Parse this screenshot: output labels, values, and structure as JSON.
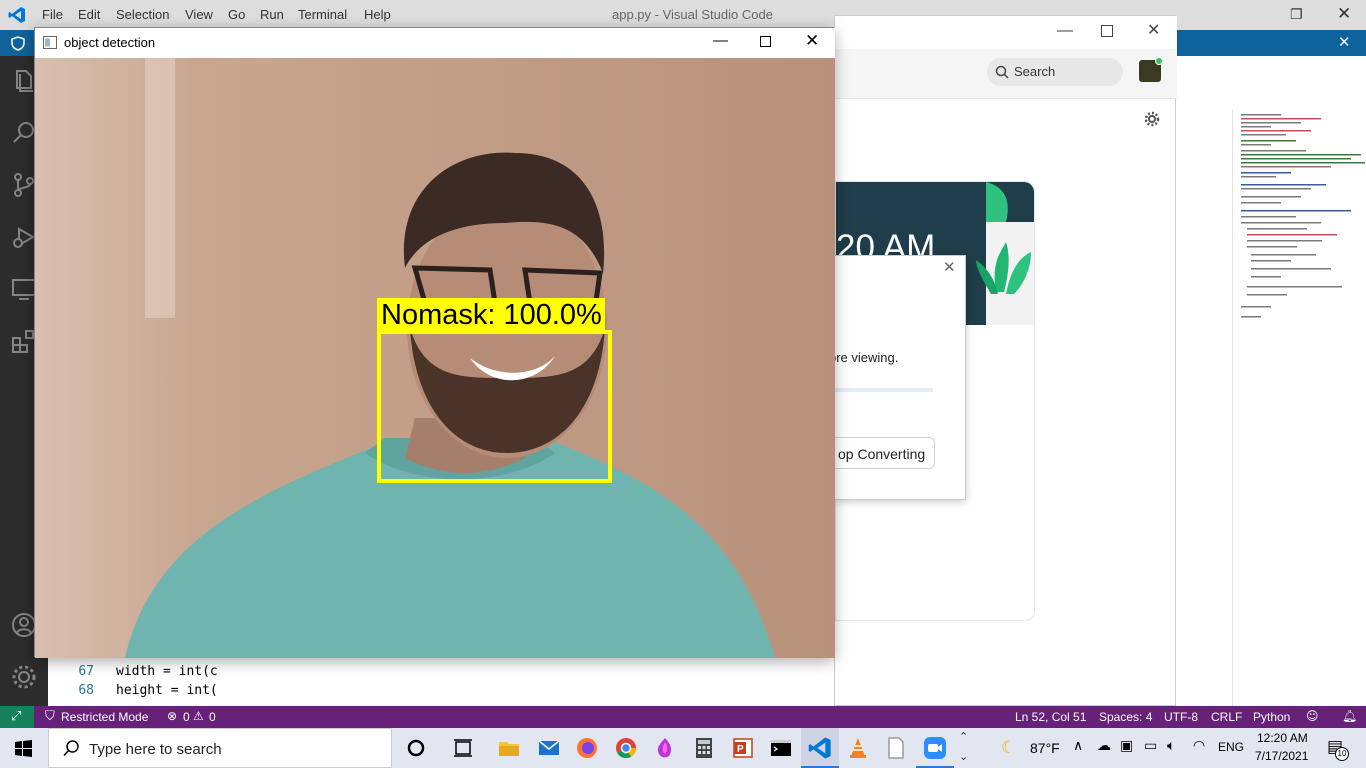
{
  "vscode": {
    "menu": [
      "File",
      "Edit",
      "Selection",
      "View",
      "Go",
      "Run",
      "Terminal",
      "Help"
    ],
    "title": "app.py - Visual Studio Code",
    "code_lines": [
      {
        "num": "67",
        "text": "width = int(c"
      },
      {
        "num": "68",
        "text": "height = int("
      }
    ],
    "status": {
      "mode": "Restricted Mode",
      "problems": "0",
      "warnings": "0",
      "position": "Ln 52, Col 51",
      "spaces": "Spaces: 4",
      "encoding": "UTF-8",
      "eol": "CRLF",
      "language": "Python"
    }
  },
  "zoom": {
    "search_label": "Search",
    "time_fragment": "20 AM",
    "dialog_text": "ore viewing.",
    "stop_button": "op Converting"
  },
  "object_detection": {
    "title": "object detection",
    "label": "Nomask: 100.0%",
    "box_color": "#ffff00"
  },
  "taskbar": {
    "search_placeholder": "Type here to search",
    "weather": "87°F",
    "language": "ENG",
    "time": "12:20 AM",
    "date": "7/17/2021",
    "notifications": "10"
  }
}
